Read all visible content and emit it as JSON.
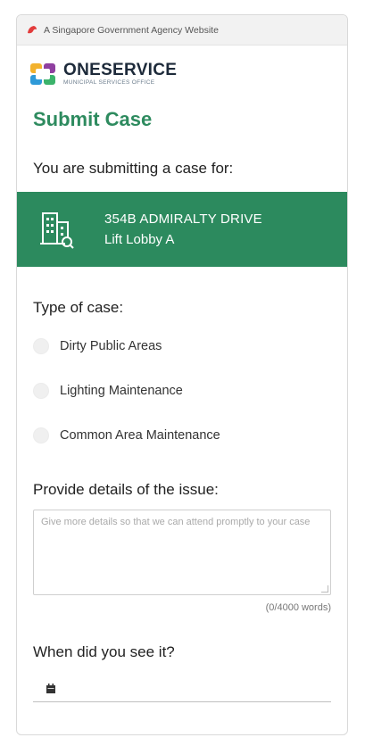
{
  "gov_bar": {
    "text": "A Singapore Government Agency Website",
    "icon": "lion-head-icon"
  },
  "brand": {
    "name": "ONESERVICE",
    "subtitle": "MUNICIPAL SERVICES OFFICE",
    "icon": "oneservice-logo-icon"
  },
  "page_title": "Submit Case",
  "submitting_for_label": "You are submitting a case for:",
  "location": {
    "icon": "building-icon",
    "address": "354B ADMIRALTY DRIVE",
    "sublocation": "Lift Lobby A",
    "background_color": "#2c8a5e"
  },
  "case_type": {
    "label": "Type of case:",
    "options": [
      {
        "label": "Dirty Public Areas",
        "selected": false
      },
      {
        "label": "Lighting Maintenance",
        "selected": false
      },
      {
        "label": "Common Area Maintenance",
        "selected": false
      }
    ]
  },
  "details": {
    "label": "Provide details of the issue:",
    "placeholder": "Give more details so that we can attend promptly to your case",
    "value": "",
    "word_count": "(0/4000 words)"
  },
  "when": {
    "label": "When did you see it?",
    "value": "",
    "icon": "calendar-icon"
  },
  "colors": {
    "accent_green": "#2e8b5f",
    "banner_green": "#2c8a5e",
    "brand_navy": "#1d2a3a"
  }
}
